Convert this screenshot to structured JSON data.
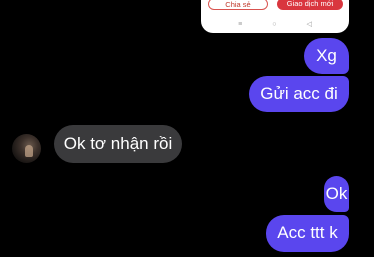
{
  "shared_card": {
    "share_label": "Chia sẻ",
    "new_transaction_label": "Giao dịch mới"
  },
  "android_nav": {
    "recent_icon": "≡",
    "home_icon": "○",
    "back_icon": "◁"
  },
  "messages": [
    {
      "side": "sent",
      "text": "Xg"
    },
    {
      "side": "sent",
      "text": "Gửi acc đi"
    },
    {
      "side": "received",
      "text": "Ok tơ nhận rồi"
    },
    {
      "side": "sent",
      "text": "Ok"
    },
    {
      "side": "sent",
      "text": "Acc ttt k"
    }
  ],
  "colors": {
    "background": "#000000",
    "sent_bubble": "#5a46ee",
    "received_bubble": "#3a3a3c",
    "card_accent": "#d9363e"
  }
}
